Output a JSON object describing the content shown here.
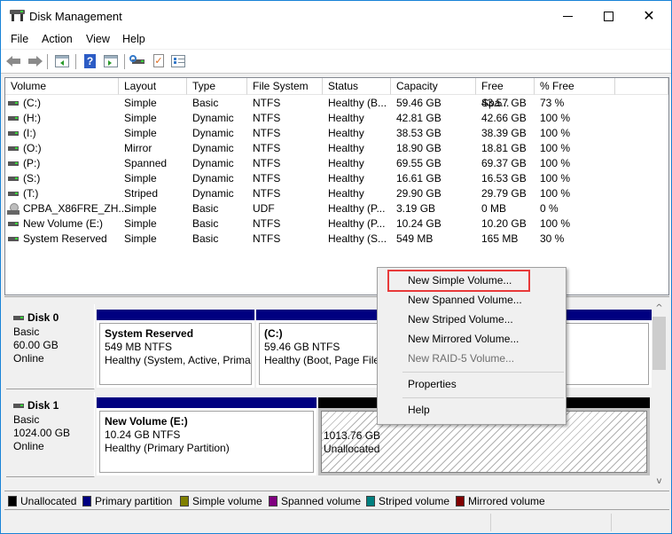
{
  "window": {
    "title": "Disk Management",
    "icon": "disk-management-icon",
    "controls": {
      "minimize": "minimize-icon",
      "maximize": "maximize-icon",
      "close": "✕"
    }
  },
  "menu": [
    "File",
    "Action",
    "View",
    "Help"
  ],
  "toolbar": {
    "buttons": [
      "back-icon",
      "forward-icon",
      "show-hide-console-tree-icon",
      "help-icon",
      "show-hide-action-pane-icon",
      "rescan-disks-icon",
      "properties-icon",
      "settings-list-icon"
    ],
    "help_glyph": "?",
    "check_glyph": "✓"
  },
  "volume_list": {
    "columns": [
      "Volume",
      "Layout",
      "Type",
      "File System",
      "Status",
      "Capacity",
      "Free Spa...",
      "% Free"
    ],
    "rows": [
      {
        "icon": "drive",
        "volume": "(C:)",
        "layout": "Simple",
        "type": "Basic",
        "fs": "NTFS",
        "status": "Healthy (B...",
        "capacity": "59.46 GB",
        "free": "43.57 GB",
        "pct": "73 %"
      },
      {
        "icon": "drive",
        "volume": "(H:)",
        "layout": "Simple",
        "type": "Dynamic",
        "fs": "NTFS",
        "status": "Healthy",
        "capacity": "42.81 GB",
        "free": "42.66 GB",
        "pct": "100 %"
      },
      {
        "icon": "drive",
        "volume": "(I:)",
        "layout": "Simple",
        "type": "Dynamic",
        "fs": "NTFS",
        "status": "Healthy",
        "capacity": "38.53 GB",
        "free": "38.39 GB",
        "pct": "100 %"
      },
      {
        "icon": "drive",
        "volume": "(O:)",
        "layout": "Mirror",
        "type": "Dynamic",
        "fs": "NTFS",
        "status": "Healthy",
        "capacity": "18.90 GB",
        "free": "18.81 GB",
        "pct": "100 %"
      },
      {
        "icon": "drive",
        "volume": "(P:)",
        "layout": "Spanned",
        "type": "Dynamic",
        "fs": "NTFS",
        "status": "Healthy",
        "capacity": "69.55 GB",
        "free": "69.37 GB",
        "pct": "100 %"
      },
      {
        "icon": "drive",
        "volume": "(S:)",
        "layout": "Simple",
        "type": "Dynamic",
        "fs": "NTFS",
        "status": "Healthy",
        "capacity": "16.61 GB",
        "free": "16.53 GB",
        "pct": "100 %"
      },
      {
        "icon": "drive",
        "volume": "(T:)",
        "layout": "Striped",
        "type": "Dynamic",
        "fs": "NTFS",
        "status": "Healthy",
        "capacity": "29.90 GB",
        "free": "29.79 GB",
        "pct": "100 %"
      },
      {
        "icon": "cd",
        "volume": "CPBA_X86FRE_ZH...",
        "layout": "Simple",
        "type": "Basic",
        "fs": "UDF",
        "status": "Healthy (P...",
        "capacity": "3.19 GB",
        "free": "0 MB",
        "pct": "0 %"
      },
      {
        "icon": "drive",
        "volume": "New Volume (E:)",
        "layout": "Simple",
        "type": "Basic",
        "fs": "NTFS",
        "status": "Healthy (P...",
        "capacity": "10.24 GB",
        "free": "10.20 GB",
        "pct": "100 %"
      },
      {
        "icon": "drive",
        "volume": "System Reserved",
        "layout": "Simple",
        "type": "Basic",
        "fs": "NTFS",
        "status": "Healthy (S...",
        "capacity": "549 MB",
        "free": "165 MB",
        "pct": "30 %"
      }
    ]
  },
  "disks": [
    {
      "name": "Disk 0",
      "type": "Basic",
      "size": "60.00 GB",
      "state": "Online",
      "partitions": [
        {
          "title": "System Reserved",
          "line1": "549 MB NTFS",
          "line2": "Healthy (System, Active, Primar",
          "bar_color": "#000080",
          "kind": "primary"
        },
        {
          "title": " (C:)",
          "line1": "59.46 GB NTFS",
          "line2": "Healthy (Boot, Page File, Crash Dump, Primary Partition)",
          "bar_color": "#000080",
          "kind": "primary"
        }
      ]
    },
    {
      "name": "Disk 1",
      "type": "Basic",
      "size": "1024.00 GB",
      "state": "Online",
      "partitions": [
        {
          "title": "New Volume  (E:)",
          "line1": "10.24 GB NTFS",
          "line2": "Healthy (Primary Partition)",
          "bar_color": "#000080",
          "kind": "primary"
        },
        {
          "title": "",
          "line1": "1013.76 GB",
          "line2": "Unallocated",
          "bar_color": "#000000",
          "kind": "unallocated"
        }
      ]
    }
  ],
  "legend": [
    {
      "label": "Unallocated",
      "color": "#000000"
    },
    {
      "label": "Primary partition",
      "color": "#000080"
    },
    {
      "label": "Simple volume",
      "color": "#808000"
    },
    {
      "label": "Spanned volume",
      "color": "#800080"
    },
    {
      "label": "Striped volume",
      "color": "#008080"
    },
    {
      "label": "Mirrored volume",
      "color": "#800000"
    }
  ],
  "scrollbar": {
    "up": "^",
    "down": "v"
  },
  "context_menu": {
    "items": [
      {
        "label": "New Simple Volume...",
        "enabled": true,
        "highlighted": true
      },
      {
        "label": "New Spanned Volume...",
        "enabled": true
      },
      {
        "label": "New Striped Volume...",
        "enabled": true
      },
      {
        "label": "New Mirrored Volume...",
        "enabled": true
      },
      {
        "label": "New RAID-5 Volume...",
        "enabled": false
      },
      {
        "label": "Properties",
        "enabled": true
      },
      {
        "label": "Help",
        "enabled": true
      }
    ],
    "highlight_color": "#e83a3a"
  }
}
